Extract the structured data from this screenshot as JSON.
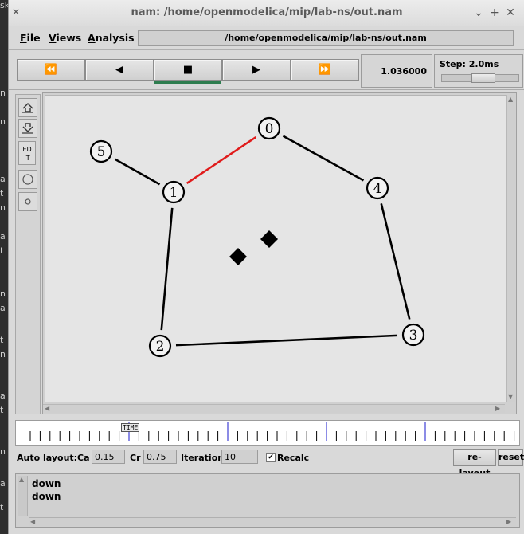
{
  "window": {
    "title": "nam: /home/openmodelica/mip/lab-ns/out.nam",
    "buttons": [
      "⌄",
      "+",
      "✕"
    ]
  },
  "menu": {
    "file": "File",
    "views": "Views",
    "analysis": "Analysis",
    "path": "/home/openmodelica/mip/lab-ns/out.nam"
  },
  "playback": {
    "rewind_icon": "⏪",
    "back_icon": "◀",
    "stop_icon": "■",
    "play_icon": "▶",
    "forward_icon": "⏩",
    "time": "1.036000",
    "step_label": "Step: 2.0ms",
    "step_slider_fraction": 0.55,
    "active_button": "stop",
    "active_color": "#2e7d4f"
  },
  "tools": {
    "zoom_in_icon": "zoom-in-icon",
    "zoom_out_icon": "zoom-out-icon",
    "edit_label": "ED IT"
  },
  "network": {
    "nodes": [
      {
        "id": "0"
      },
      {
        "id": "1"
      },
      {
        "id": "2"
      },
      {
        "id": "3"
      },
      {
        "id": "4"
      },
      {
        "id": "5"
      }
    ],
    "links": [
      {
        "from": "0",
        "to": "1",
        "status": "down",
        "color": "#e01b1b"
      },
      {
        "from": "0",
        "to": "4",
        "status": "up",
        "color": "#000000"
      },
      {
        "from": "1",
        "to": "5",
        "status": "up",
        "color": "#000000"
      },
      {
        "from": "1",
        "to": "2",
        "status": "up",
        "color": "#000000"
      },
      {
        "from": "2",
        "to": "3",
        "status": "up",
        "color": "#000000"
      },
      {
        "from": "3",
        "to": "4",
        "status": "up",
        "color": "#000000"
      }
    ],
    "packet_count": 2
  },
  "timeline": {
    "marker_label": "TIME"
  },
  "layout": {
    "auto_layout_label": "Auto layout:",
    "ca_label": "Ca",
    "ca_value": "0.15",
    "cr_label": "Cr",
    "cr_value": "0.75",
    "iterations_label": "Iterations",
    "iterations_value": "10",
    "recalc_label": "Recalc",
    "recalc_checked": true,
    "relayout_label": "re-layout",
    "reset_label": "reset"
  },
  "log": {
    "lines": [
      "down",
      "down"
    ]
  },
  "background_text": [
    "sk",
    "n",
    "n",
    "a",
    "t",
    "n",
    "a",
    "t",
    "n",
    "a",
    "t",
    "n",
    "a",
    "t",
    "n",
    "a",
    "t"
  ]
}
